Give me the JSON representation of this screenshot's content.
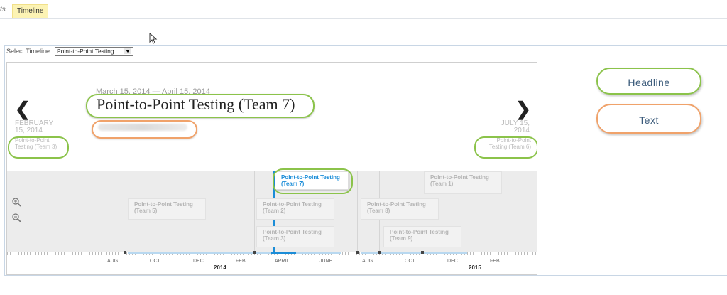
{
  "tabs": {
    "left_label": "ts",
    "active_label": "Timeline"
  },
  "selector": {
    "label": "Select Timeline",
    "value": "Point-to-Point Testing"
  },
  "slide": {
    "date_range": "March 15, 2014 — April 15, 2014",
    "headline": "Point-to-Point Testing (Team 7)",
    "prev": {
      "date": "FEBRUARY 15, 2014",
      "title": "Point-to-Point Testing (Team 3)",
      "arrow": "❮"
    },
    "next": {
      "date": "JULY 15, 2014",
      "title": "Point-to-Point Testing (Team 6)",
      "arrow": "❯"
    }
  },
  "markers": [
    {
      "label": "Point-to-Point Testing (Team 7)",
      "active": true
    },
    {
      "label": "Point-to-Point Testing (Team 1)"
    },
    {
      "label": "Point-to-Point Testing (Team 5)"
    },
    {
      "label": "Point-to-Point Testing (Team 2)"
    },
    {
      "label": "Point-to-Point Testing (Team 8)"
    },
    {
      "label": "Point-to-Point Testing (Team 3)"
    },
    {
      "label": "Point-to-Point Testing (Team 9)"
    }
  ],
  "ruler": {
    "months": [
      "AUG.",
      "OCT.",
      "DEC.",
      "FEB.",
      "APRIL",
      "JUNE",
      "AUG.",
      "OCT.",
      "DEC.",
      "FEB."
    ],
    "years": [
      "2014",
      "2015"
    ]
  },
  "zoom": {
    "in_icon": "zoom-in-icon",
    "out_icon": "zoom-out-icon"
  },
  "legend": {
    "headline": "Headline",
    "text": "Text"
  },
  "colors": {
    "highlight_green": "#8bc34a",
    "highlight_orange": "#f0a26a",
    "active_blue": "#1b8dd8",
    "tab_yellow": "#fcf3b4"
  }
}
